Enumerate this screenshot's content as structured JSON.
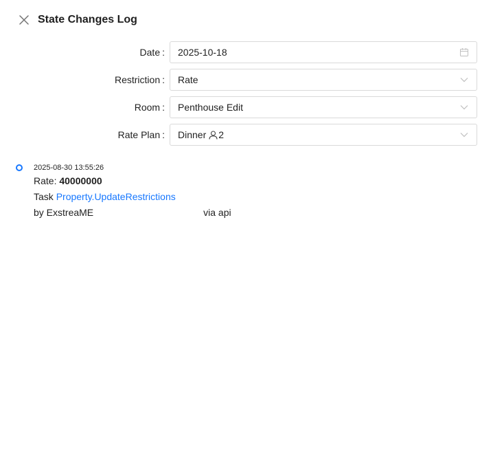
{
  "drawer": {
    "title": "State Changes Log"
  },
  "form": {
    "date": {
      "label": "Date",
      "value": "2025-10-18"
    },
    "restriction": {
      "label": "Restriction",
      "value": "Rate"
    },
    "room": {
      "label": "Room",
      "value": "Penthouse Edit"
    },
    "rate_plan": {
      "label": "Rate Plan",
      "value": "Dinner",
      "occupancy": "2"
    }
  },
  "timeline": [
    {
      "timestamp": "2025-08-30 13:55:26",
      "field_label": "Rate:",
      "field_value": "40000000",
      "task_prefix": "Task",
      "task_link": "Property.UpdateRestrictions",
      "by_prefix": "by ExstreaME",
      "via": "via api"
    }
  ],
  "colors": {
    "accent": "#1677ff",
    "border": "#d9d9d9",
    "icon": "#bfbfbf"
  }
}
